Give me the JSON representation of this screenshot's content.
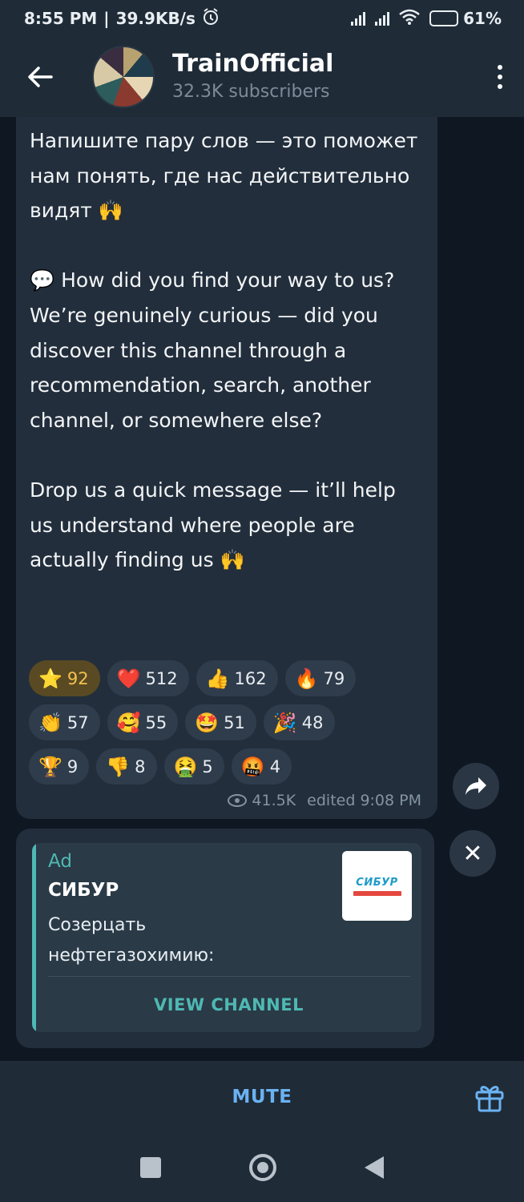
{
  "status_bar": {
    "time": "8:55 PM",
    "speed": "39.9KB/s",
    "battery": "61%"
  },
  "header": {
    "title": "TrainOfficial",
    "subscribers": "32.3K subscribers"
  },
  "message": {
    "text": "Напишите пару слов — это поможет нам понять, где нас действительно видят 🙌\n\n💬 How did you find your way to us?\nWe’re genuinely curious — did you discover this channel through a recommendation, search, another channel, or somewhere else?\n\nDrop us a quick message — it’ll help us understand where people are actually finding us 🙌",
    "reactions": [
      {
        "emoji": "⭐",
        "count": "92",
        "active": true
      },
      {
        "emoji": "❤️",
        "count": "512"
      },
      {
        "emoji": "👍",
        "count": "162"
      },
      {
        "emoji": "🔥",
        "count": "79"
      },
      {
        "emoji": "👏",
        "count": "57"
      },
      {
        "emoji": "🥰",
        "count": "55"
      },
      {
        "emoji": "🤩",
        "count": "51"
      },
      {
        "emoji": "🎉",
        "count": "48"
      },
      {
        "emoji": "🏆",
        "count": "9"
      },
      {
        "emoji": "👎",
        "count": "8"
      },
      {
        "emoji": "🤮",
        "count": "5"
      },
      {
        "emoji": "🤬",
        "count": "4"
      }
    ],
    "views": "41.5K",
    "edited": "edited 9:08 PM"
  },
  "ad": {
    "label": "Ad",
    "name": "СИБУР",
    "text": "Созерцать нефтегазохимию:",
    "cta": "VIEW CHANNEL",
    "logo_text": "СИБУР"
  },
  "bottom": {
    "mute_label": "MUTE"
  },
  "colors": {
    "accent": "#6ab2f2",
    "ad_accent": "#4fb8b3",
    "bubble": "#222e3b",
    "background": "#0f1822"
  }
}
